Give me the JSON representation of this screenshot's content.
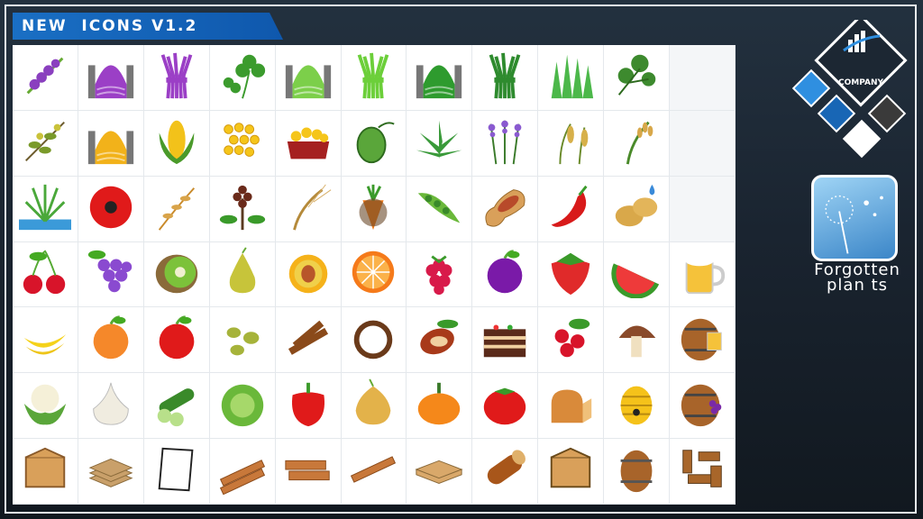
{
  "header": {
    "title": "NEW  ICONS V1.2"
  },
  "company_logo": {
    "label": "COMPANY",
    "colors": [
      "#2f8fe0",
      "#1866b5",
      "#3a3a3a",
      "#ffffff"
    ]
  },
  "mod_logo": {
    "text_line1": "Forgotten",
    "text_line2": "plan ts"
  },
  "grid": {
    "rows": [
      [
        "lupine-icon",
        "purple-silage-bunker-icon",
        "purple-grass-bundle-icon",
        "clover-icon",
        "clover-silage-bunker-icon",
        "clover-bundle-icon",
        "green-silage-bunker-icon",
        "grass-bundle-icon",
        "grass-icon",
        "parsley-icon",
        ""
      ],
      [
        "olive-branch-icon",
        "yellow-silage-bunker-icon",
        "corn-cob-icon",
        "corn-kernels-icon",
        "corn-tray-icon",
        "hops-icon",
        "hemp-leaf-icon",
        "lavender-icon",
        "millet-icon",
        "wheat-stalk-icon",
        ""
      ],
      [
        "rice-plant-icon",
        "poppy-icon",
        "oat-icon",
        "coffee-plant-icon",
        "barley-icon",
        "carrot-icon",
        "pea-pod-icon",
        "peanut-icon",
        "chili-pepper-icon",
        "potato-icon",
        ""
      ],
      [
        "cherry-icon",
        "grapes-icon",
        "kiwi-icon",
        "pear-icon",
        "peach-icon",
        "orange-icon",
        "raspberry-icon",
        "plum-icon",
        "strawberry-icon",
        "watermelon-icon",
        "beer-mug-icon"
      ],
      [
        "banana-icon",
        "apricot-icon",
        "apple-icon",
        "olives-icon",
        "cinnamon-icon",
        "coconut-icon",
        "cocoa-pod-icon",
        "cake-icon",
        "cranberry-icon",
        "mushroom-icon",
        "beer-barrel-icon"
      ],
      [
        "cauliflower-icon",
        "garlic-icon",
        "cucumber-icon",
        "cabbage-icon",
        "bell-pepper-icon",
        "onion-icon",
        "pumpkin-icon",
        "tomato-icon",
        "bread-icon",
        "beehive-icon",
        "wine-barrel-icon"
      ],
      [
        "cardboard-box-icon",
        "cardboard-sheets-icon",
        "paper-icon",
        "planks-icon",
        "boards-icon",
        "beam-icon",
        "pallet-icon",
        "log-icon",
        "wooden-crate-icon",
        "barrel-icon",
        "wood-scraps-icon"
      ]
    ]
  }
}
